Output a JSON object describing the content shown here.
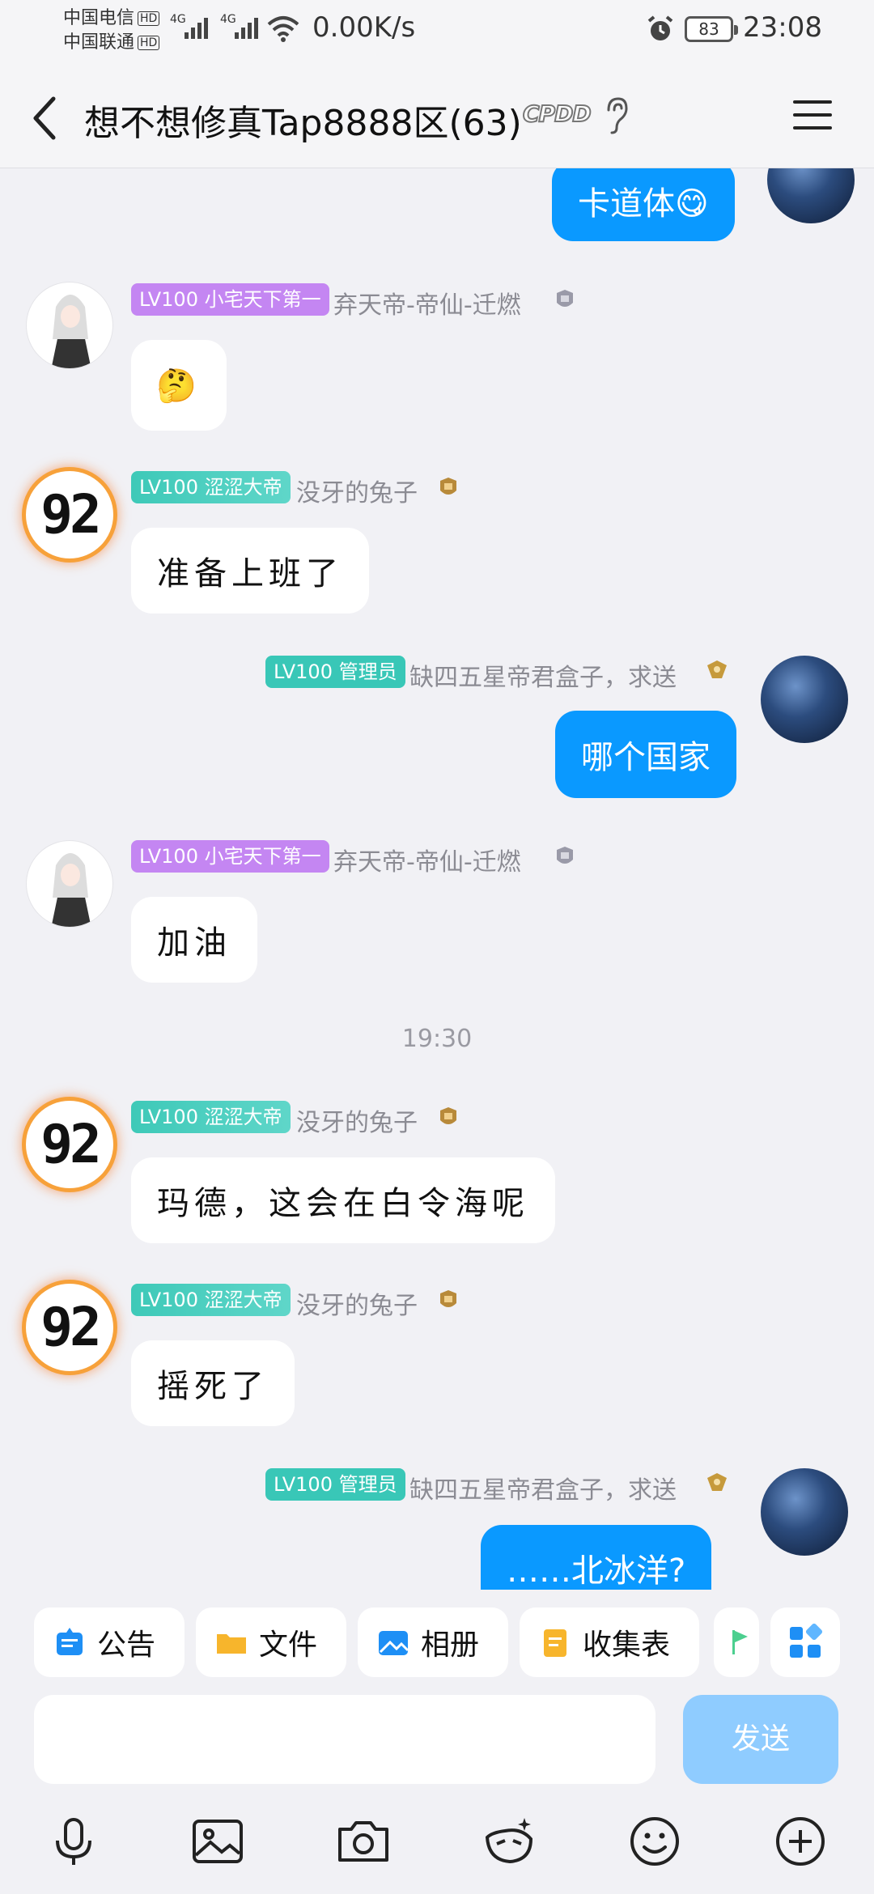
{
  "status_bar": {
    "carrier1": "中国电信",
    "carrier2": "中国联通",
    "hd": "HD",
    "network": "4G",
    "speed": "0.00K/s",
    "battery": "83",
    "time": "23:08"
  },
  "header": {
    "title": "想不想修真Tap8888区(63)",
    "tag": "CPDD"
  },
  "messages": [
    {
      "text": "卡道体😋"
    },
    {
      "badge": "LV100 小宅天下第一",
      "name": "弃天帝-帝仙-迁燃",
      "text": "🤔"
    },
    {
      "badge": "LV100 涩涩大帝",
      "name": "没牙的兔子",
      "text": "准备上班了"
    },
    {
      "badge": "LV100 管理员",
      "name": "缺四五星帝君盒子，求送",
      "text": "哪个国家"
    },
    {
      "badge": "LV100 小宅天下第一",
      "name": "弃天帝-帝仙-迁燃",
      "text": "加油"
    },
    {
      "badge": "LV100 涩涩大帝",
      "name": "没牙的兔子",
      "text": "玛德，这会在白令海呢"
    },
    {
      "badge": "LV100 涩涩大帝",
      "name": "没牙的兔子",
      "text": "摇死了"
    },
    {
      "badge": "LV100 管理员",
      "name": "缺四五星帝君盒子，求送",
      "text": "……北冰洋?"
    }
  ],
  "time_separator": "19:30",
  "avatar_92": "92",
  "tools": [
    {
      "label": "公告",
      "icon": "announcement-icon",
      "color": "#1e8ff5"
    },
    {
      "label": "文件",
      "icon": "folder-icon",
      "color": "#f7b52c"
    },
    {
      "label": "相册",
      "icon": "album-icon",
      "color": "#1e8ff5"
    },
    {
      "label": "收集表",
      "icon": "form-icon",
      "color": "#f7b52c"
    }
  ],
  "input": {
    "placeholder": "",
    "send_label": "发送"
  },
  "bottom_icons": [
    "microphone-icon",
    "image-icon",
    "camera-icon",
    "sticker-icon",
    "emoji-icon",
    "plus-icon"
  ],
  "colors": {
    "accent": "#0a99ff",
    "send_disabled": "#8fccff",
    "badge_purple": "#c486f2",
    "badge_teal": "#39c7b7"
  }
}
